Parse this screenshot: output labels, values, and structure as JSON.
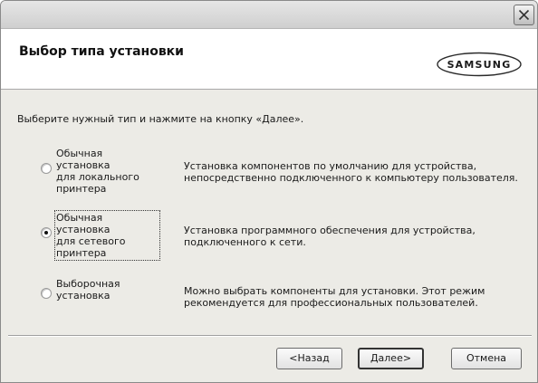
{
  "window": {
    "close_symbol": "×"
  },
  "header": {
    "title": "Выбор типа установки",
    "logo_text": "SAMSUNG"
  },
  "instruction": "Выберите нужный тип и нажмите на кнопку «Далее».",
  "options": [
    {
      "label": "Обычная установка\nдля локального\nпринтера",
      "description": "Установка компонентов по умолчанию для устройства,\nнепосредственно подключенного к компьютеру пользователя.",
      "selected": false
    },
    {
      "label": "Обычная установка\nдля сетевого\nпринтера",
      "description": "Установка программного обеспечения для устройства,\nподключенного к сети.",
      "selected": true
    },
    {
      "label": "Выборочная\nустановка",
      "description": "Можно выбрать компоненты для установки. Этот режим\nрекомендуется для профессиональных пользователей.",
      "selected": false
    }
  ],
  "buttons": {
    "back": "<Назад",
    "next": "Далее>",
    "cancel": "Отмена"
  }
}
